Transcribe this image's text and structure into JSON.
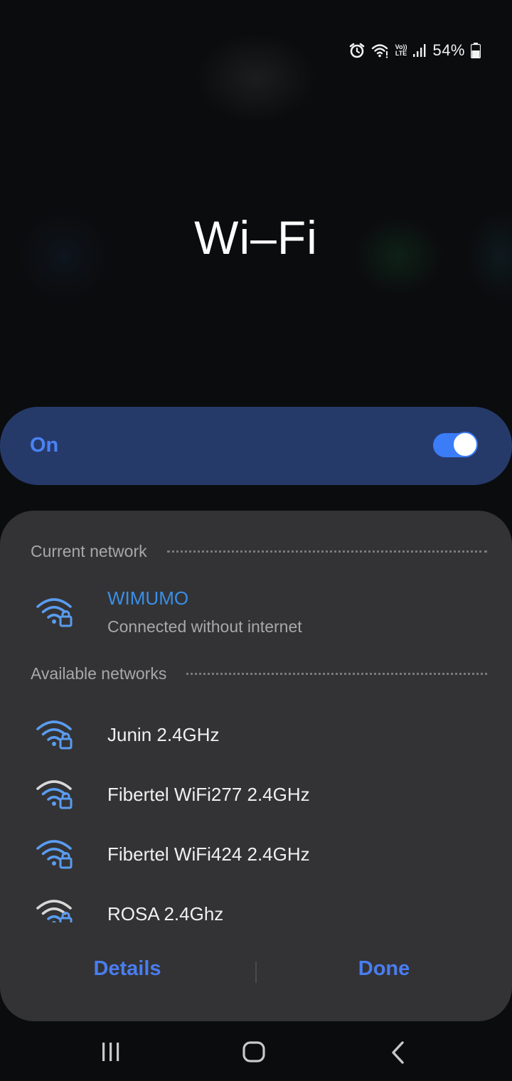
{
  "status_bar": {
    "battery_percent": "54%",
    "lte_label_top": "Vo))",
    "lte_label_bottom": "LTE",
    "icons": [
      "alarm-icon",
      "wifi-status-icon",
      "volte-icon",
      "cell-signal-icon",
      "battery-icon"
    ]
  },
  "title": "Wi–Fi",
  "toggle": {
    "label": "On",
    "state": true
  },
  "current_network": {
    "header": "Current network",
    "name": "WIMUMO",
    "status": "Connected without internet"
  },
  "available_networks": {
    "header": "Available networks",
    "items": [
      {
        "name": "Junin 2.4GHz",
        "signal": "full",
        "secured": true
      },
      {
        "name": "Fibertel WiFi277 2.4GHz",
        "signal": "weak",
        "secured": true
      },
      {
        "name": "Fibertel WiFi424 2.4GHz",
        "signal": "full",
        "secured": true
      },
      {
        "name": "ROSA 2.4Ghz",
        "signal": "weak",
        "secured": true
      }
    ]
  },
  "buttons": {
    "details": "Details",
    "done": "Done"
  },
  "navbar": {
    "icons": [
      "recent-apps-icon",
      "home-icon",
      "back-icon"
    ]
  },
  "colors": {
    "accent": "#3b7cf7",
    "connected_text": "#3a8ee6",
    "panel": "#333335",
    "toggle_row": "#263a6a",
    "wifi_full": "#5a9cf0",
    "wifi_weak": "#d8d8d8"
  }
}
